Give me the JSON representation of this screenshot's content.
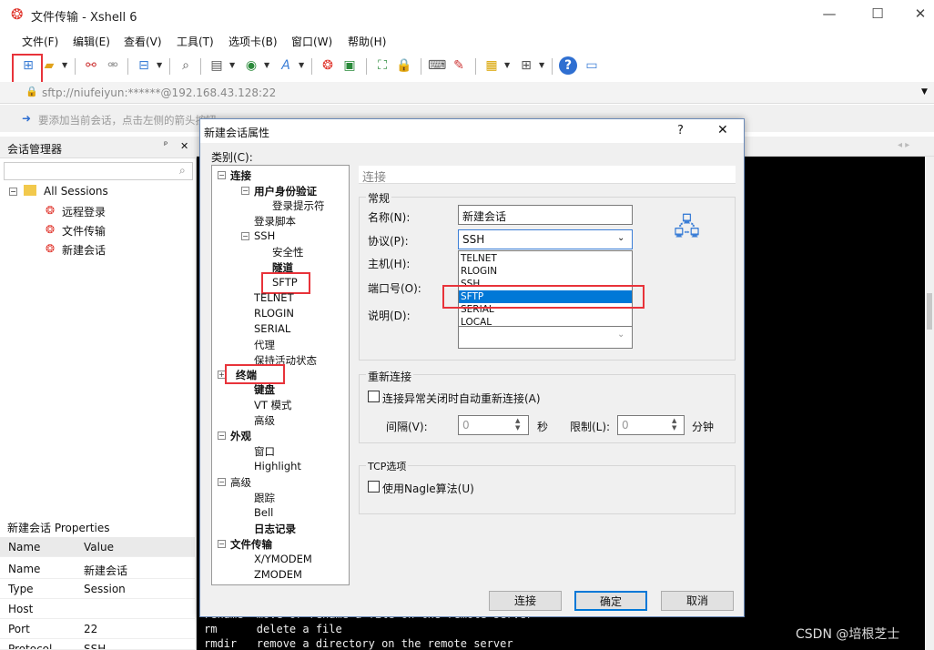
{
  "window": {
    "title": "文件传输 - Xshell 6",
    "min": "—",
    "max": "☐",
    "close": "✕"
  },
  "menu": [
    "文件(F)",
    "编辑(E)",
    "查看(V)",
    "工具(T)",
    "选项卡(B)",
    "窗口(W)",
    "帮助(H)"
  ],
  "address": "sftp://niufeiyun:******@192.168.43.128:22",
  "notice": "要添加当前会话，点击左侧的箭头按钮。",
  "session_manager": {
    "title": "会话管理器",
    "pin": "📌",
    "close": "✕",
    "root": "All Sessions",
    "items": [
      "远程登录",
      "文件传输",
      "新建会话"
    ]
  },
  "properties": {
    "title": "新建会话 Properties",
    "header": [
      "Name",
      "Value"
    ],
    "rows": [
      [
        "Name",
        "新建会话"
      ],
      [
        "Type",
        "Session"
      ],
      [
        "Host",
        ""
      ],
      [
        "Port",
        "22"
      ],
      [
        "Protocol",
        "SSH"
      ]
    ]
  },
  "terminal": {
    "lines": [
      "rename  move or rename a file on the remote server",
      "rm      delete a file",
      "rmdir   remove a directory on the remote server"
    ]
  },
  "dialog": {
    "title": "新建会话属性",
    "help": "?",
    "close": "✕",
    "category_label": "类别(C):",
    "tree": [
      "连接",
      "用户身份验证",
      "登录提示符",
      "登录脚本",
      "SSH",
      "安全性",
      "隧道",
      "SFTP",
      "TELNET",
      "RLOGIN",
      "SERIAL",
      "代理",
      "保持活动状态",
      "终端",
      "键盘",
      "VT 模式",
      "高级",
      "外观",
      "窗口",
      "Highlight",
      "高级",
      "跟踪",
      "Bell",
      "日志记录",
      "文件传输",
      "X/YMODEM",
      "ZMODEM"
    ],
    "section_header": "连接",
    "general": "常规",
    "name_label": "名称(N):",
    "name_value": "新建会话",
    "protocol_label": "协议(P):",
    "protocol_value": "SSH",
    "host_label": "主机(H):",
    "port_label": "端口号(O):",
    "desc_label": "说明(D):",
    "protocol_options": [
      "TELNET",
      "RLOGIN",
      "SSH",
      "SFTP",
      "SERIAL",
      "LOCAL"
    ],
    "reconnect_title": "重新连接",
    "reconnect_check": "连接异常关闭时自动重新连接(A)",
    "interval_label": "间隔(V):",
    "interval_value": "0",
    "sec": "秒",
    "limit_label": "限制(L):",
    "limit_value": "0",
    "min": "分钟",
    "tcp_title": "TCP选项",
    "nagle_check": "使用Nagle算法(U)",
    "btn_connect": "连接",
    "btn_ok": "确定",
    "btn_cancel": "取消"
  },
  "watermark": "CSDN @培根芝士"
}
